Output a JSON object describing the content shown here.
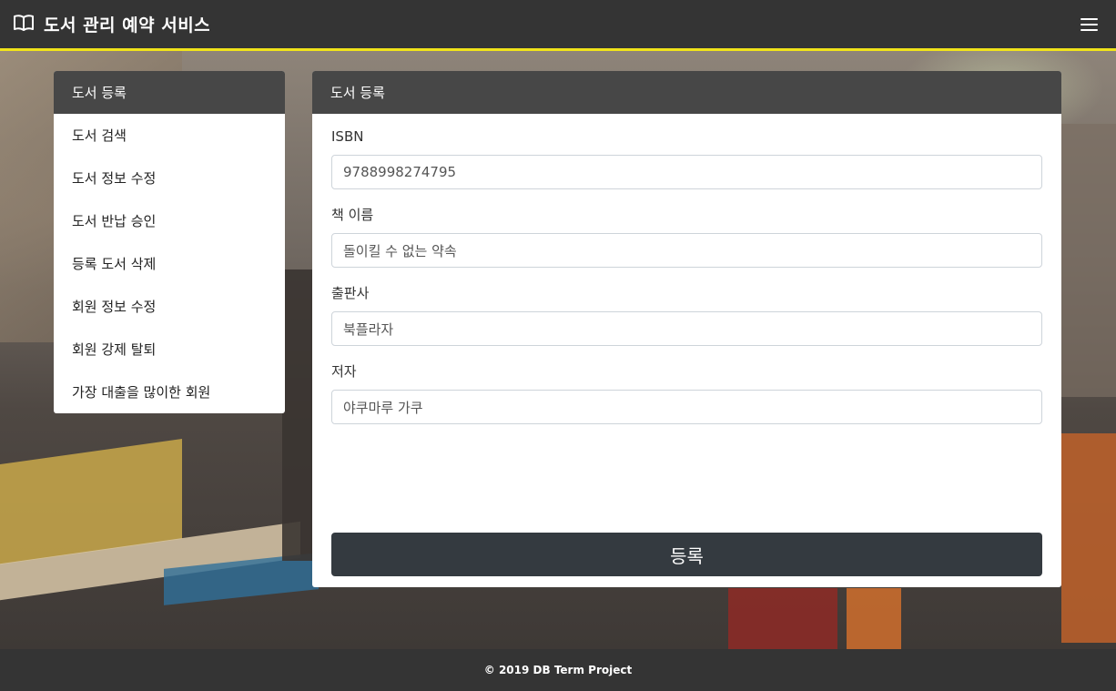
{
  "app": {
    "title": "도서 관리 예약 서비스"
  },
  "sidebar": {
    "items": [
      {
        "label": "도서 등록"
      },
      {
        "label": "도서 검색"
      },
      {
        "label": "도서 정보 수정"
      },
      {
        "label": "도서 반납 승인"
      },
      {
        "label": "등록 도서 삭제"
      },
      {
        "label": "회원 정보 수정"
      },
      {
        "label": "회원 강제 탈퇴"
      },
      {
        "label": "가장 대출을 많이한 회원"
      }
    ]
  },
  "panel": {
    "title": "도서 등록",
    "fields": [
      {
        "label": "ISBN",
        "value": "9788998274795"
      },
      {
        "label": "책 이름",
        "value": "돌이킬 수 없는 약속"
      },
      {
        "label": "출판사",
        "value": "북플라자"
      },
      {
        "label": "저자",
        "value": "야쿠마루 가쿠"
      }
    ],
    "submit_label": "등록"
  },
  "footer": {
    "text": "© 2019 DB Term Project"
  },
  "colors": {
    "accent": "#f1e31a",
    "topbar": "#343434",
    "header": "#474747",
    "button": "#343a40"
  },
  "icons": {
    "brand": "book-open-icon",
    "menu": "hamburger-menu-icon"
  }
}
